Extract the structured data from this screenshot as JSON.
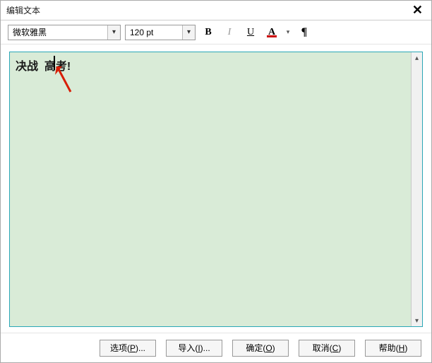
{
  "window": {
    "title": "编辑文本"
  },
  "toolbar": {
    "font_family": "微软雅黑",
    "font_size": "120 pt",
    "bold": "B",
    "italic": "I",
    "underline": "U",
    "fontcolor_letter": "A",
    "pilcrow": "¶"
  },
  "canvas": {
    "text_before": "决战",
    "text_after": "高考!",
    "bg_color": "#d9ebd7",
    "arrow_color": "#d81e06"
  },
  "buttons": {
    "options": {
      "label": "选项",
      "mnemonic": "P"
    },
    "import": {
      "label": "导入",
      "mnemonic": "I"
    },
    "ok": {
      "label": "确定",
      "mnemonic": "O"
    },
    "cancel": {
      "label": "取消",
      "mnemonic": "C"
    },
    "help": {
      "label": "帮助",
      "mnemonic": "H"
    }
  },
  "ellipsis": "...",
  "paren_open": "(",
  "paren_close": ")"
}
